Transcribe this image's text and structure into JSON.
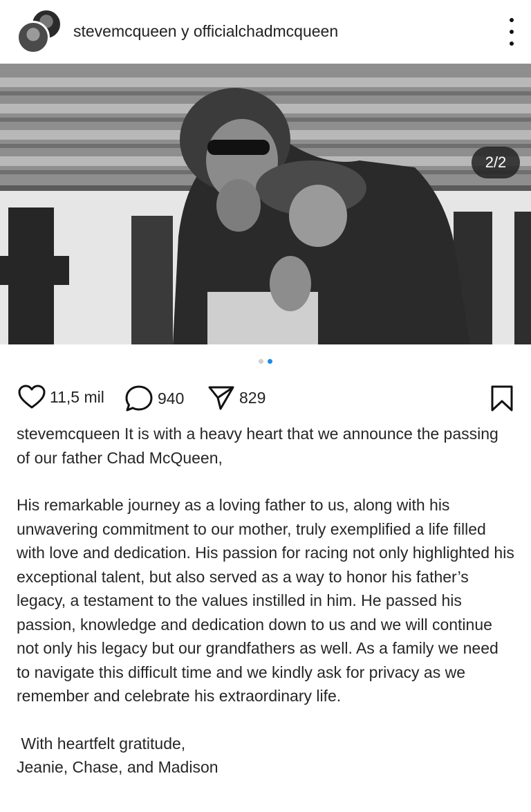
{
  "header": {
    "usernames": "stevemcqueen y officialchadmcqueen",
    "more_icon": "more-vertical-icon"
  },
  "media": {
    "counter": "2/2",
    "slide_count": 2,
    "active_slide": 2
  },
  "actions": {
    "likes": "11,5 mil",
    "comments": "940",
    "shares": "829",
    "icons": [
      "heart-icon",
      "comment-icon",
      "send-icon",
      "bookmark-icon"
    ]
  },
  "caption": {
    "username": "stevemcqueen",
    "line1": " It is with a heavy heart that we announce the passing of our father Chad McQueen,",
    "paragraph2": "His remarkable journey as a loving father to us, along with his unwavering commitment to our mother, truly exemplified a life filled with love and dedication. His passion for racing not only highlighted his exceptional talent, but also served as a way to honor his father’s legacy, a testament to the values instilled in him. He passed his passion, knowledge and dedication down to us and we will continue not only his legacy but our grandfathers as well. As a family we need to navigate this difficult time and we kindly ask for privacy as we remember and celebrate his extraordinary life.",
    "signoff": " With heartfelt gratitude,",
    "signature": "Jeanie, Chase, and Madison"
  },
  "colors": {
    "accent_dot": "#1a8cef",
    "text": "#262626"
  }
}
